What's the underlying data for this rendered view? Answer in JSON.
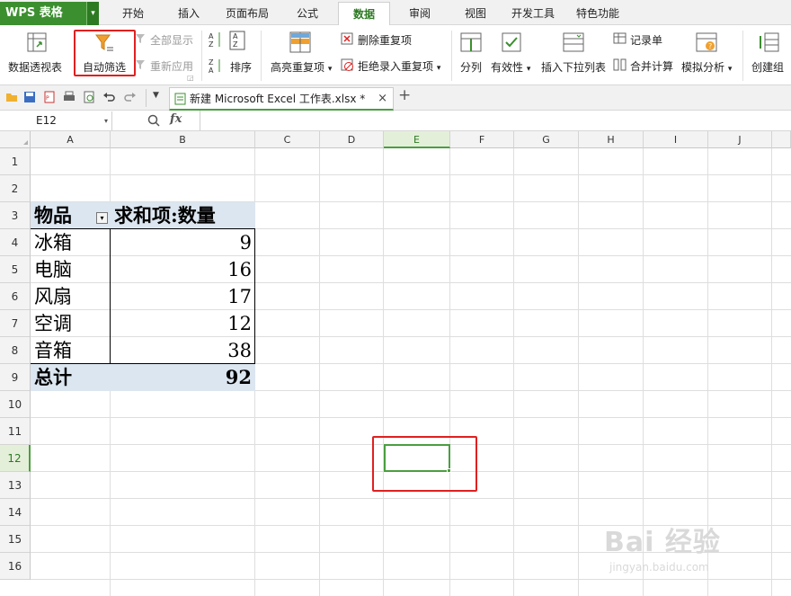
{
  "app": {
    "name": "WPS 表格",
    "dropdown": "▾"
  },
  "menu": {
    "tabs": [
      "开始",
      "插入",
      "页面布局",
      "公式",
      "数据",
      "审阅",
      "视图",
      "开发工具",
      "特色功能"
    ],
    "active": "数据"
  },
  "ribbon": {
    "pivot_label": "数据透视表",
    "autofilter_label": "自动筛选",
    "show_all_label": "全部显示",
    "reapply_label": "重新应用",
    "sort_label": "排序",
    "highlight_dup_label": "高亮重复项",
    "remove_dup_label": "删除重复项",
    "reject_dup_label": "拒绝录入重复项",
    "split_label": "分列",
    "validity_label": "有效性",
    "dropdown_label": "插入下拉列表",
    "record_label": "记录单",
    "consolidate_label": "合并计算",
    "whatif_label": "模拟分析",
    "group_label": "创建组"
  },
  "document": {
    "tab_title": "新建 Microsoft Excel 工作表.xlsx *",
    "close": "×",
    "add": "+"
  },
  "formula_bar": {
    "name_box": "E12",
    "fx": "fx"
  },
  "columns": [
    "A",
    "B",
    "C",
    "D",
    "E",
    "F",
    "G",
    "H",
    "I",
    "J"
  ],
  "rows": [
    "1",
    "2",
    "3",
    "4",
    "5",
    "6",
    "7",
    "8",
    "9",
    "10",
    "11",
    "12",
    "13",
    "14",
    "15",
    "16"
  ],
  "pivot": {
    "header": {
      "item": "物品",
      "sum": "求和项:数量"
    },
    "items": [
      {
        "name": "冰箱",
        "qty": "9"
      },
      {
        "name": "电脑",
        "qty": "16"
      },
      {
        "name": "风扇",
        "qty": "17"
      },
      {
        "name": "空调",
        "qty": "12"
      },
      {
        "name": "音箱",
        "qty": "38"
      }
    ],
    "total": {
      "label": "总计",
      "qty": "92"
    }
  },
  "watermark": {
    "brand": "Bai 经验",
    "url": "jingyan.baidu.com"
  },
  "colors": {
    "accent": "#4b9e3f",
    "brand": "#3c8f2f",
    "highlight": "#e02020",
    "pivot_header": "#dce6f1"
  }
}
